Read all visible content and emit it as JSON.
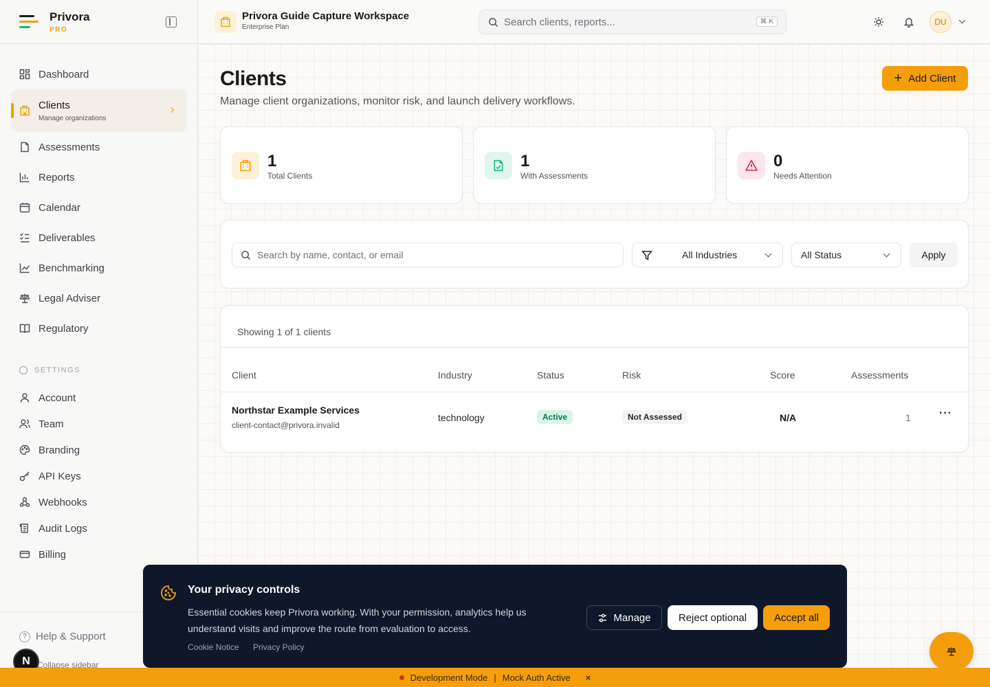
{
  "brand": {
    "name": "Privora",
    "tier": "PRO"
  },
  "sidebar": {
    "items": [
      {
        "label": "Dashboard",
        "icon": "dashboard-icon"
      },
      {
        "label": "Clients",
        "sublabel": "Manage organizations",
        "icon": "building-icon",
        "active": true
      },
      {
        "label": "Assessments",
        "icon": "file-icon"
      },
      {
        "label": "Reports",
        "icon": "bar-chart-icon"
      },
      {
        "label": "Calendar",
        "icon": "calendar-icon"
      },
      {
        "label": "Deliverables",
        "icon": "checklist-icon"
      },
      {
        "label": "Benchmarking",
        "icon": "line-chart-icon"
      },
      {
        "label": "Legal Adviser",
        "icon": "scale-icon"
      },
      {
        "label": "Regulatory",
        "icon": "book-icon"
      }
    ],
    "settings_label": "SETTINGS",
    "settings_items": [
      {
        "label": "Account",
        "icon": "user-icon"
      },
      {
        "label": "Team",
        "icon": "users-icon"
      },
      {
        "label": "Branding",
        "icon": "palette-icon"
      },
      {
        "label": "API Keys",
        "icon": "key-icon"
      },
      {
        "label": "Webhooks",
        "icon": "webhook-icon"
      },
      {
        "label": "Audit Logs",
        "icon": "scroll-icon"
      },
      {
        "label": "Billing",
        "icon": "credit-card-icon"
      }
    ],
    "help_label": "Help & Support",
    "collapse_label": "Collapse sidebar"
  },
  "header": {
    "workspace_title": "Privora Guide Capture Workspace",
    "workspace_plan": "Enterprise Plan",
    "search_placeholder": "Search clients, reports...",
    "search_shortcut": "⌘ K",
    "avatar_initials": "DU"
  },
  "page": {
    "title": "Clients",
    "subtitle": "Manage client organizations, monitor risk, and launch delivery workflows.",
    "add_button": "Add Client"
  },
  "stats": [
    {
      "value": "1",
      "label": "Total Clients",
      "color": "#f59e0b",
      "bg": "#fdf1d9"
    },
    {
      "value": "1",
      "label": "With Assessments",
      "color": "#10b981",
      "bg": "#e3f6ee"
    },
    {
      "value": "0",
      "label": "Needs Attention",
      "color": "#e11d48",
      "bg": "#fde7ec"
    }
  ],
  "filters": {
    "search_placeholder": "Search by name, contact, or email",
    "industry": "All Industries",
    "status": "All Status",
    "apply": "Apply"
  },
  "table": {
    "showing": "Showing 1 of 1 clients",
    "columns": [
      "Client",
      "Industry",
      "Status",
      "Risk",
      "Score",
      "Assessments"
    ],
    "rows": [
      {
        "name": "Northstar Example Services",
        "email": "client-contact@privora.invalid",
        "industry": "technology",
        "status": "Active",
        "risk": "Not Assessed",
        "score": "N/A",
        "assessments": "1"
      }
    ]
  },
  "cookie": {
    "title": "Your privacy controls",
    "text": "Essential cookies keep Privora working. With your permission, analytics help us understand visits and improve the route from evaluation to access.",
    "notice_link": "Cookie Notice",
    "policy_link": "Privacy Policy",
    "manage": "Manage",
    "reject": "Reject optional",
    "accept": "Accept all"
  },
  "devbar": {
    "mode": "Development Mode",
    "sep": "|",
    "auth": "Mock Auth Active",
    "close": "×"
  },
  "floating": {
    "initial": "N"
  },
  "colors": {
    "accent": "#f59e0b",
    "dark": "#0f172a"
  }
}
